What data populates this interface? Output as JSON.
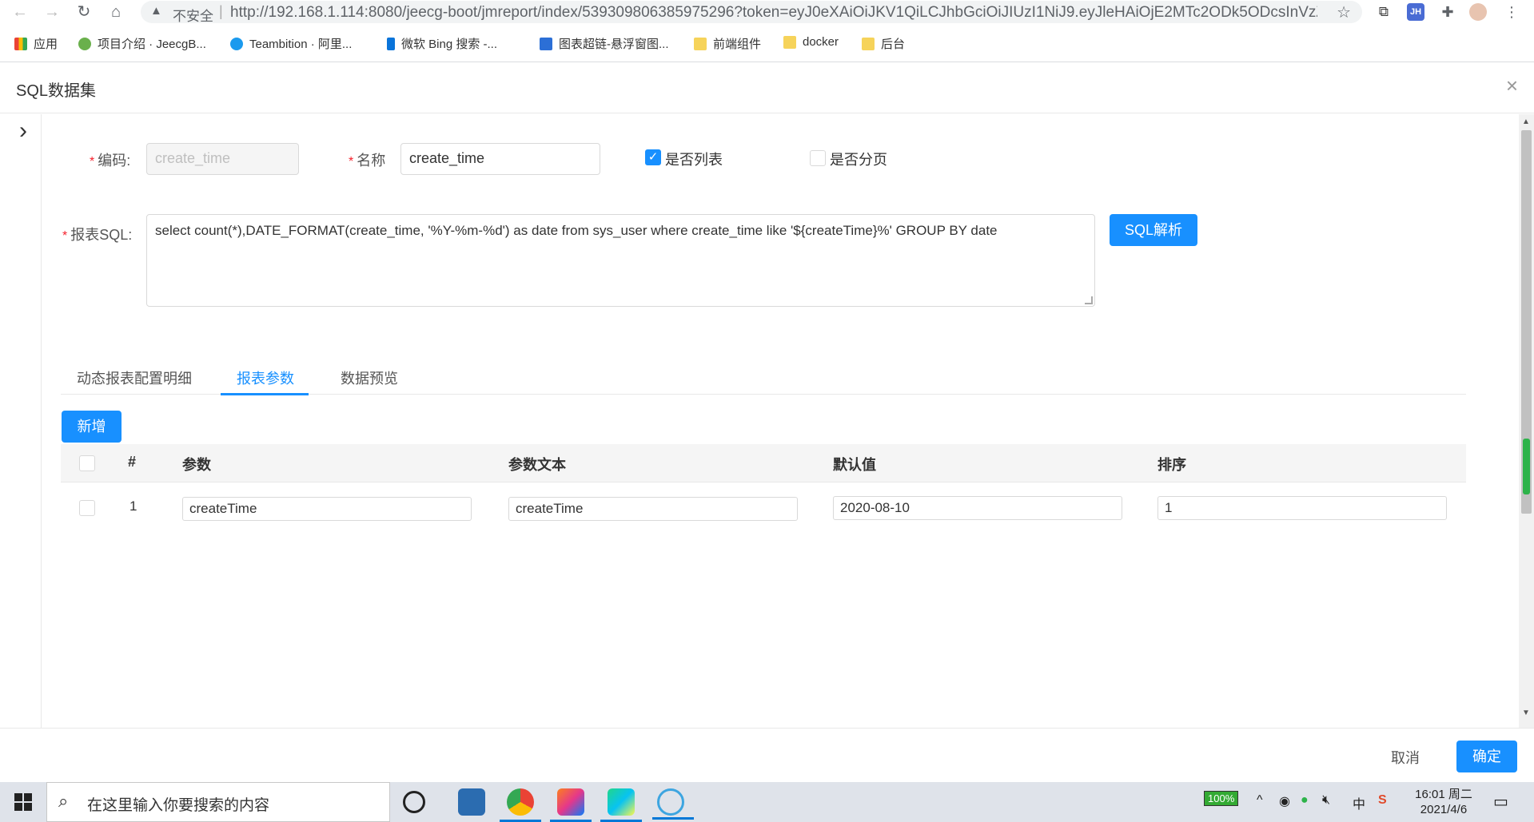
{
  "browser": {
    "security_warning": "不安全",
    "url": "http://192.168.1.114:8080/jeecg-boot/jmreport/index/539309806385975296?token=eyJ0eXAiOiJKV1QiLCJhbGciOiJIUzI1NiJ9.eyJleHAiOjE2MTc2ODk5ODcsInVzZ...",
    "ext_jh": "JH"
  },
  "bookmarks": [
    {
      "label": "应用",
      "icon": "apps-grid-icon"
    },
    {
      "label": "项目介绍 · JeecgB...",
      "icon": "jeecg-icon"
    },
    {
      "label": "Teambition · 阿里...",
      "icon": "teambition-icon"
    },
    {
      "label": "微软 Bing 搜索 -...",
      "icon": "bing-icon"
    },
    {
      "label": "图表超链-悬浮窗图...",
      "icon": "site-icon"
    },
    {
      "label": "前端组件",
      "icon": "folder-icon"
    },
    {
      "label": "docker",
      "icon": "folder-icon"
    },
    {
      "label": "后台",
      "icon": "folder-icon"
    }
  ],
  "dialog": {
    "title": "SQL数据集",
    "close_symbol": "×",
    "collapse_symbol": "›"
  },
  "form": {
    "code_label": "编码:",
    "code_value": "create_time",
    "name_label": "名称",
    "name_value": "create_time",
    "is_list_label": "是否列表",
    "is_list_checked": true,
    "is_page_label": "是否分页",
    "is_page_checked": false,
    "sql_label": "报表SQL:",
    "sql_value": "select count(*),DATE_FORMAT(create_time, '%Y-%m-%d') as date  from sys_user where create_time like '${createTime}%' GROUP BY date",
    "parse_button": "SQL解析",
    "required_mark": "*"
  },
  "tabs": [
    {
      "label": "动态报表配置明细",
      "active": false
    },
    {
      "label": "报表参数",
      "active": true
    },
    {
      "label": "数据预览",
      "active": false
    }
  ],
  "params": {
    "add_button": "新增",
    "columns": [
      "#",
      "参数",
      "参数文本",
      "默认值",
      "排序"
    ],
    "rows": [
      {
        "index": "1",
        "param": "createTime",
        "text": "createTime",
        "default": "2020-08-10",
        "order": "1"
      }
    ]
  },
  "footer": {
    "cancel": "取消",
    "confirm": "确定"
  },
  "taskbar": {
    "search_placeholder": "在这里输入你要搜索的内容",
    "battery": "100%",
    "ime": "中",
    "time": "16:01 周二",
    "date": "2021/4/6",
    "colors": {
      "accent": "#0078d7"
    }
  },
  "colors": {
    "primary": "#1890ff",
    "required": "#f5222d"
  }
}
